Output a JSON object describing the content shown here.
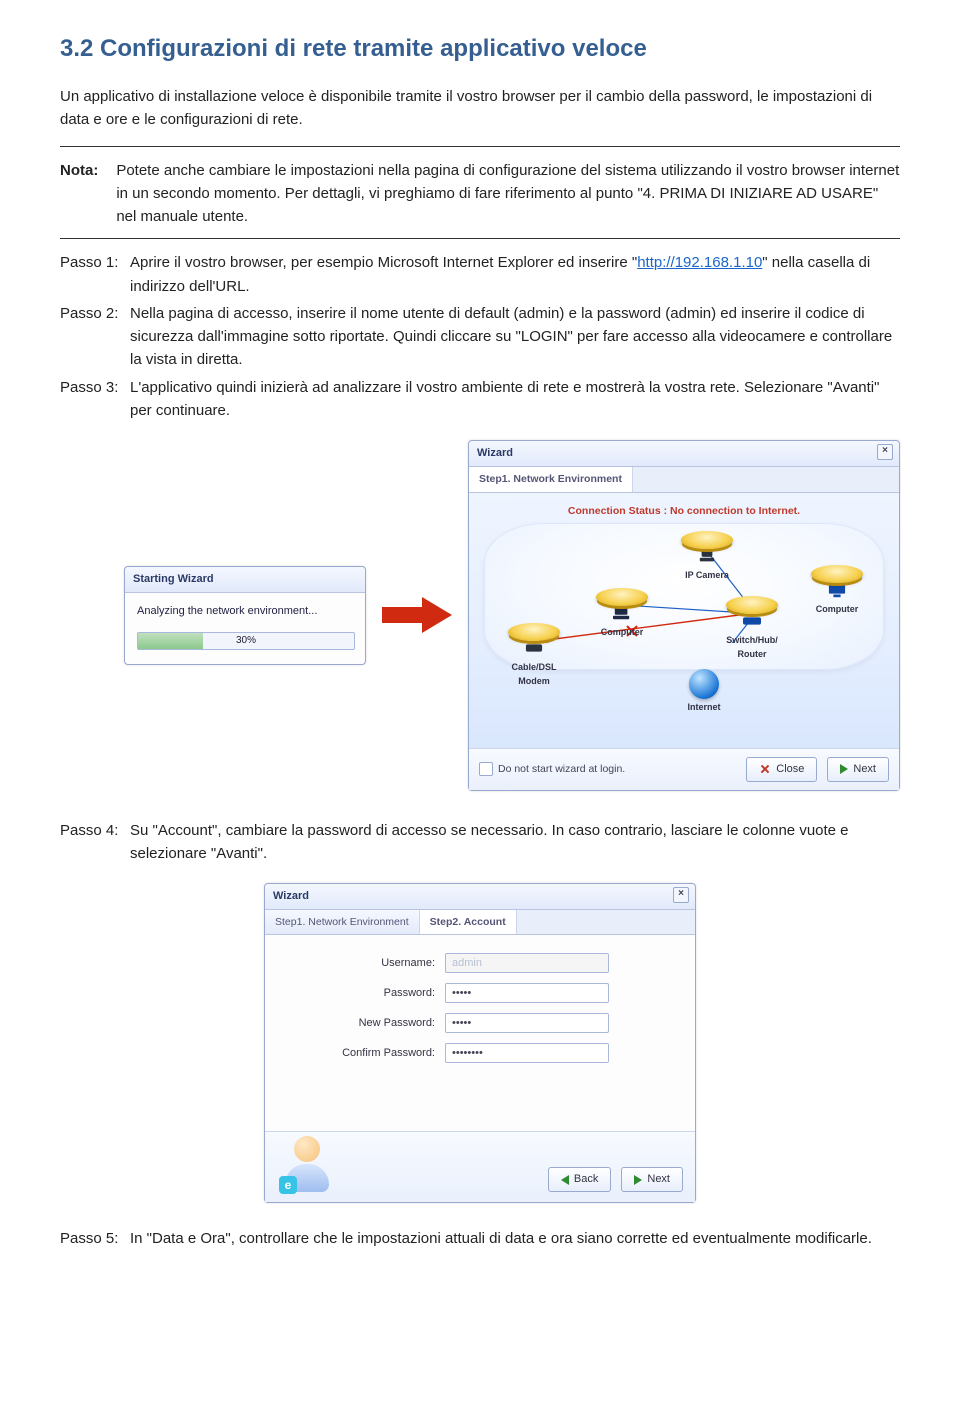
{
  "heading": "3.2 Configurazioni di rete tramite applicativo veloce",
  "intro": "Un applicativo di installazione veloce è disponibile tramite il vostro browser per il cambio della password, le impostazioni di data e ore e le configurazioni di rete.",
  "nota_label": "Nota:",
  "nota_text": "Potete anche cambiare le impostazioni nella pagina di configurazione del sistema utilizzando il vostro browser internet in un secondo momento. Per dettagli, vi preghiamo di fare riferimento al punto \"4. PRIMA DI INIZIARE AD USARE\" nel manuale utente.",
  "passo1": {
    "label": "Passo 1:",
    "pre": "Aprire il vostro browser, per esempio Microsoft Internet Explorer ed inserire \"",
    "link": "http://192.168.1.10",
    "post": "\" nella casella di indirizzo dell'URL."
  },
  "passo2": {
    "label": "Passo 2:",
    "text": "Nella pagina di accesso, inserire il nome utente di default (admin) e la password (admin) ed inserire il codice di sicurezza dall'immagine sotto riportate. Quindi cliccare su \"LOGIN\" per fare accesso alla videocamere e controllare la vista in diretta."
  },
  "passo3": {
    "label": "Passo 3:",
    "text": "L'applicativo quindi inizierà ad analizzare il vostro ambiente di rete e mostrerà la vostra rete. Selezionare \"Avanti\" per continuare."
  },
  "passo4": {
    "label": "Passo 4:",
    "text": "Su \"Account\", cambiare la password di accesso se necessario. In caso contrario, lasciare le colonne vuote e selezionare \"Avanti\"."
  },
  "passo5": {
    "label": "Passo 5:",
    "text": "In \"Data e Ora\", controllare che le impostazioni attuali di data e ora siano corrette ed eventualmente modificarle."
  },
  "starting_wizard": {
    "title": "Starting Wizard",
    "msg": "Analyzing the network environment...",
    "pct": "30%"
  },
  "net_wizard": {
    "title": "Wizard",
    "tab": "Step1. Network Environment",
    "status": "Connection Status : No connection to Internet.",
    "labels": {
      "ipcam": "IP Camera",
      "computer": "Computer",
      "switch": "Switch/Hub/\nRouter",
      "modem": "Cable/DSL\nModem",
      "internet": "Internet"
    },
    "no_start": "Do not start wizard at login.",
    "close": "Close",
    "next": "Next"
  },
  "acct_wizard": {
    "title": "Wizard",
    "tab1": "Step1. Network Environment",
    "tab2": "Step2. Account",
    "fields": {
      "username_label": "Username:",
      "username_value": "admin",
      "password_label": "Password:",
      "password_value": "•••••",
      "newpass_label": "New Password:",
      "newpass_value": "•••••",
      "confirm_label": "Confirm Password:",
      "confirm_value": "••••••••"
    },
    "avatar_badge": "e",
    "back": "Back",
    "next": "Next"
  }
}
